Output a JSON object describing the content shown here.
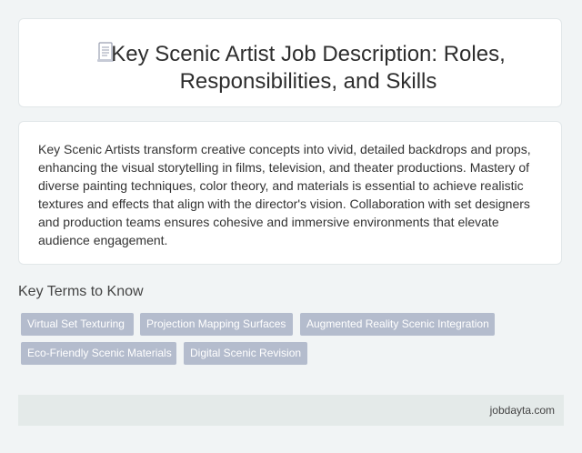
{
  "header": {
    "title": "Key Scenic Artist Job Description: Roles, Responsibilities, and Skills",
    "icon": "document-icon"
  },
  "description": {
    "text": "Key Scenic Artists transform creative concepts into vivid, detailed backdrops and props, enhancing the visual storytelling in films, television, and theater productions. Mastery of diverse painting techniques, color theory, and materials is essential to achieve realistic textures and effects that align with the director's vision. Collaboration with set designers and production teams ensures cohesive and immersive environments that elevate audience engagement."
  },
  "key_terms": {
    "heading": "Key Terms to Know",
    "tags": [
      "Virtual Set Texturing",
      "Projection Mapping Surfaces",
      "Augmented Reality Scenic Integration",
      "Eco-Friendly Scenic Materials",
      "Digital Scenic Revision"
    ]
  },
  "footer": {
    "site": "jobdayta.com"
  },
  "colors": {
    "background": "#f1f4f5",
    "tag_bg": "#b4bccd",
    "footer_bg": "#e4eae9"
  }
}
